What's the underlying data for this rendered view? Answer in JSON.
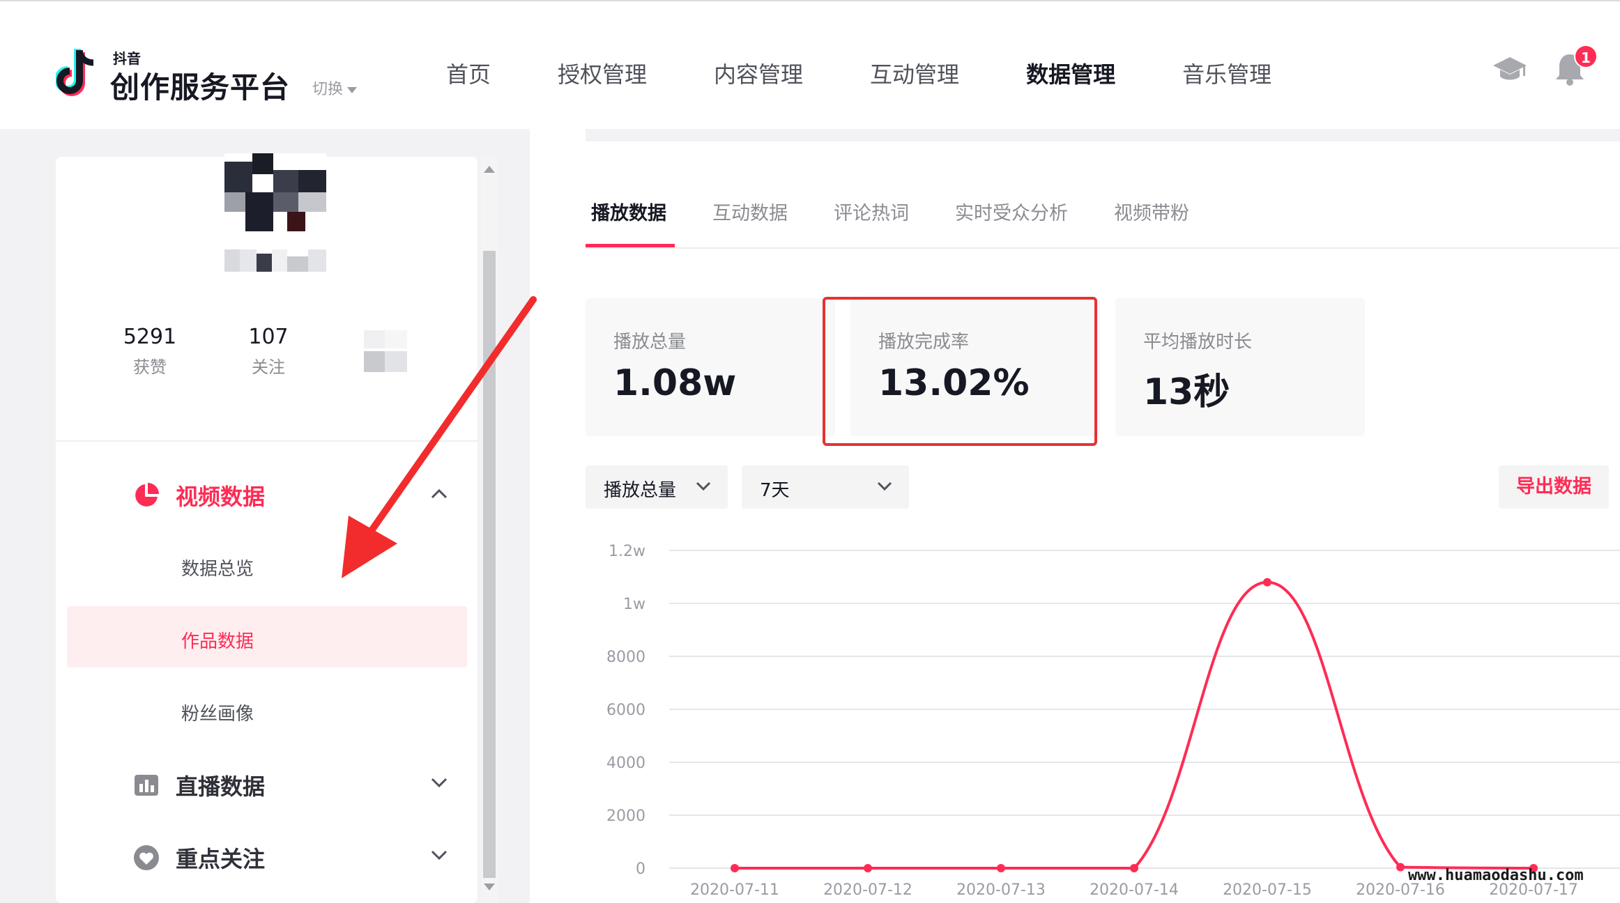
{
  "header": {
    "brand_small": "抖音",
    "brand_big": "创作服务平台",
    "switch_label": "切换",
    "nav": [
      {
        "label": "首页",
        "active": false
      },
      {
        "label": "授权管理",
        "active": false
      },
      {
        "label": "内容管理",
        "active": false
      },
      {
        "label": "互动管理",
        "active": false
      },
      {
        "label": "数据管理",
        "active": true
      },
      {
        "label": "音乐管理",
        "active": false
      }
    ],
    "notification_count": "1",
    "icons": {
      "hat": "graduation-cap-icon",
      "bell": "bell-icon"
    }
  },
  "profile": {
    "stats": [
      {
        "value": "5291",
        "label": "获赞"
      },
      {
        "value": "107",
        "label": "关注"
      }
    ]
  },
  "sidebar": {
    "groups": [
      {
        "label": "视频数据",
        "icon": "pie-chart-icon",
        "expanded": true,
        "items": [
          {
            "label": "数据总览",
            "active": false
          },
          {
            "label": "作品数据",
            "active": true
          },
          {
            "label": "粉丝画像",
            "active": false
          }
        ]
      },
      {
        "label": "直播数据",
        "icon": "bar-chart-icon",
        "expanded": false
      },
      {
        "label": "重点关注",
        "icon": "heart-icon",
        "expanded": false
      }
    ]
  },
  "tabs": [
    {
      "label": "播放数据",
      "active": true
    },
    {
      "label": "互动数据",
      "active": false
    },
    {
      "label": "评论热词",
      "active": false
    },
    {
      "label": "实时受众分析",
      "active": false
    },
    {
      "label": "视频带粉",
      "active": false
    }
  ],
  "metrics": [
    {
      "label": "播放总量",
      "value": "1.08w"
    },
    {
      "label": "播放完成率",
      "value": "13.02%",
      "highlighted": true
    },
    {
      "label": "平均播放时长",
      "value": "13秒"
    }
  ],
  "filters": {
    "metric_select": "播放总量",
    "range_select": "7天",
    "export_label": "导出数据"
  },
  "chart_data": {
    "type": "line",
    "x": [
      "2020-07-11",
      "2020-07-12",
      "2020-07-13",
      "2020-07-14",
      "2020-07-15",
      "2020-07-16",
      "2020-07-17"
    ],
    "series": [
      {
        "values": [
          0,
          0,
          0,
          0,
          10800,
          40,
          0
        ]
      }
    ],
    "yticks": [
      "0",
      "2000",
      "4000",
      "6000",
      "8000",
      "1w",
      "1.2w"
    ],
    "ylim": [
      0,
      12000
    ],
    "grid": true,
    "color": "#fe2c55"
  },
  "watermark": "www.huamaodashu.com",
  "colors": {
    "accent": "#fe2c55",
    "highlight_border": "#e53232"
  }
}
